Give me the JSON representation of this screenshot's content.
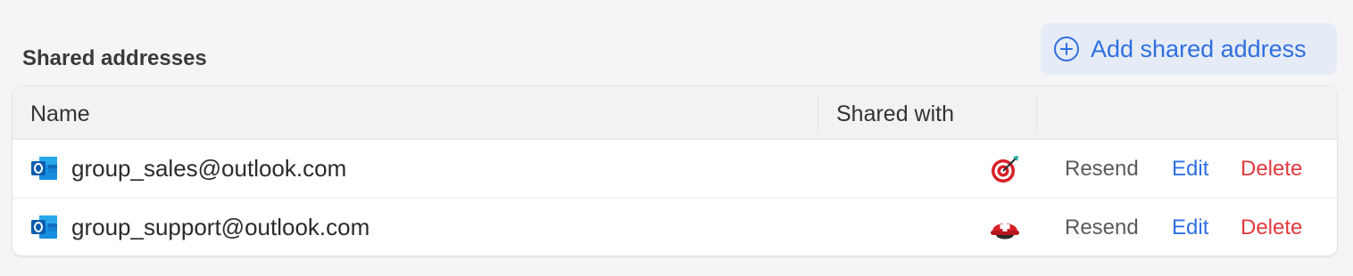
{
  "section": {
    "title": "Shared addresses"
  },
  "toolbar": {
    "add_label": "Add shared address"
  },
  "table": {
    "columns": {
      "name": "Name",
      "shared_with": "Shared with"
    },
    "rows": [
      {
        "email": "group_sales@outlook.com",
        "app_icon": "outlook-icon",
        "shared_icon": "target-dart-icon",
        "resend": "Resend",
        "edit": "Edit",
        "delete": "Delete"
      },
      {
        "email": "group_support@outlook.com",
        "app_icon": "outlook-icon",
        "shared_icon": "rescue-helmet-icon",
        "resend": "Resend",
        "edit": "Edit",
        "delete": "Delete"
      }
    ]
  },
  "colors": {
    "accent": "#2f6fe0",
    "danger": "#e0393e",
    "button_bg": "#e6ecf7"
  }
}
